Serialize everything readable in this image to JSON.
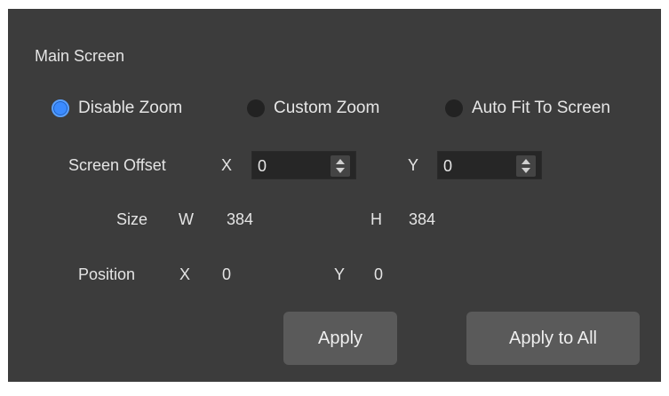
{
  "section_title": "Main Screen",
  "zoom_options": [
    {
      "label": "Disable Zoom",
      "selected": true
    },
    {
      "label": "Custom Zoom",
      "selected": false
    },
    {
      "label": "Auto Fit To Screen",
      "selected": false
    }
  ],
  "offset": {
    "label": "Screen Offset",
    "x_label": "X",
    "x_value": "0",
    "y_label": "Y",
    "y_value": "0"
  },
  "size": {
    "label": "Size",
    "w_label": "W",
    "w_value": "384",
    "h_label": "H",
    "h_value": "384"
  },
  "position": {
    "label": "Position",
    "x_label": "X",
    "x_value": "0",
    "y_label": "Y",
    "y_value": "0"
  },
  "buttons": {
    "apply": "Apply",
    "apply_all": "Apply to All"
  },
  "colors": {
    "panel_bg": "#3c3c3c",
    "accent": "#3b8bff"
  }
}
